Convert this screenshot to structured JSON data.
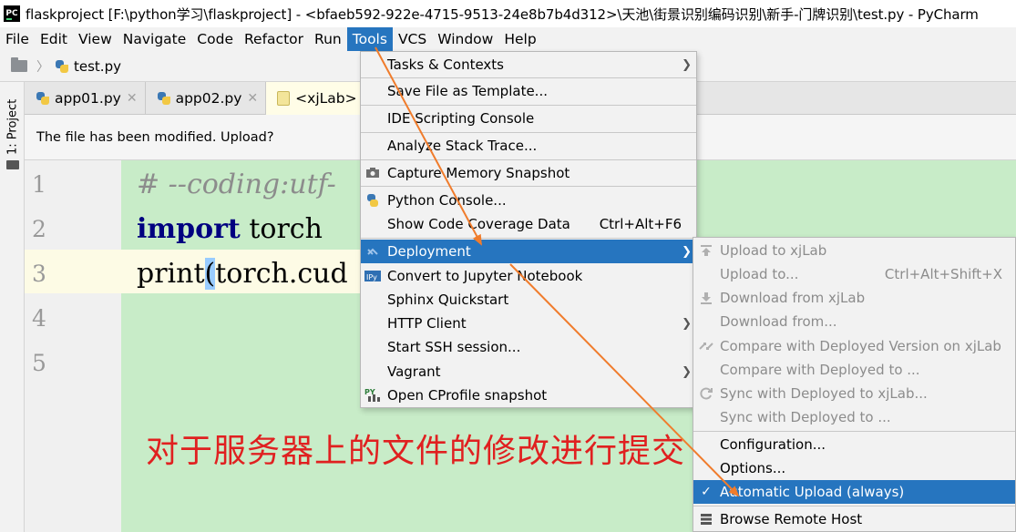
{
  "window": {
    "title": "flaskproject [F:\\python学习\\flaskproject] - <bfaeb592-922e-4715-9513-24e8b7b4d312>\\天池\\街景识别编码识别\\新手-门牌识别\\test.py - PyCharm",
    "logo_text": "PC"
  },
  "menubar": {
    "items": [
      "File",
      "Edit",
      "View",
      "Navigate",
      "Code",
      "Refactor",
      "Run",
      "Tools",
      "VCS",
      "Window",
      "Help"
    ],
    "active": "Tools"
  },
  "breadcrumb": {
    "file": "test.py"
  },
  "sidebar": {
    "project_label": "1: Project"
  },
  "tabs": [
    {
      "label": "app01.py"
    },
    {
      "label": "app02.py"
    },
    {
      "label": "<xjLab> te"
    }
  ],
  "notification": {
    "text": "The file has been modified. Upload?"
  },
  "editor": {
    "line_numbers": [
      "1",
      "2",
      "3",
      "4",
      "5"
    ],
    "lines": {
      "l1": "# --coding:utf-",
      "l2_kw": "import",
      "l2_rest": " torch",
      "l3_a": "print",
      "l3_paren": "(",
      "l3_b": "torch.cud"
    }
  },
  "annotation": {
    "text": "对于服务器上的文件的修改进行提交",
    "color": "#e02020"
  },
  "tools_menu": {
    "items": [
      {
        "label": "Tasks & Contexts",
        "shortcut": "",
        "submenu": true,
        "icon": ""
      },
      {
        "label": "Save File as Template...",
        "shortcut": "",
        "submenu": false,
        "icon": ""
      },
      {
        "label": "IDE Scripting Console",
        "shortcut": "",
        "submenu": false,
        "icon": ""
      },
      {
        "label": "Analyze Stack Trace...",
        "shortcut": "",
        "submenu": false,
        "icon": ""
      },
      {
        "label": "Capture Memory Snapshot",
        "shortcut": "",
        "submenu": false,
        "icon": "memory-snapshot-icon"
      },
      {
        "label": "Python Console...",
        "shortcut": "",
        "submenu": false,
        "icon": "python-icon"
      },
      {
        "label": "Show Code Coverage Data",
        "shortcut": "Ctrl+Alt+F6",
        "submenu": false,
        "icon": ""
      },
      {
        "label": "Deployment",
        "shortcut": "",
        "submenu": true,
        "icon": "deployment-icon"
      },
      {
        "label": "Convert to Jupyter Notebook",
        "shortcut": "",
        "submenu": false,
        "icon": "jupyter-icon"
      },
      {
        "label": "Sphinx Quickstart",
        "shortcut": "",
        "submenu": false,
        "icon": ""
      },
      {
        "label": "HTTP Client",
        "shortcut": "",
        "submenu": true,
        "icon": ""
      },
      {
        "label": "Start SSH session...",
        "shortcut": "",
        "submenu": false,
        "icon": ""
      },
      {
        "label": "Vagrant",
        "shortcut": "",
        "submenu": true,
        "icon": ""
      },
      {
        "label": "Open CProfile snapshot",
        "shortcut": "",
        "submenu": false,
        "icon": "cprofile-icon"
      }
    ],
    "active": "Deployment"
  },
  "deployment_menu": {
    "items": [
      {
        "label": "Upload to xjLab",
        "shortcut": "",
        "enabled": false,
        "icon": "upload-icon"
      },
      {
        "label": "Upload to...",
        "shortcut": "Ctrl+Alt+Shift+X",
        "enabled": false,
        "icon": ""
      },
      {
        "label": "Download from xjLab",
        "shortcut": "",
        "enabled": false,
        "icon": "download-icon"
      },
      {
        "label": "Download from...",
        "shortcut": "",
        "enabled": false,
        "icon": ""
      },
      {
        "label": "Compare with Deployed Version on xjLab",
        "shortcut": "",
        "enabled": false,
        "icon": "compare-icon"
      },
      {
        "label": "Compare with Deployed to ...",
        "shortcut": "",
        "enabled": false,
        "icon": ""
      },
      {
        "label": "Sync with Deployed to xjLab...",
        "shortcut": "",
        "enabled": false,
        "icon": "sync-icon"
      },
      {
        "label": "Sync with Deployed to ...",
        "shortcut": "",
        "enabled": false,
        "icon": ""
      },
      {
        "label": "Configuration...",
        "shortcut": "",
        "enabled": true,
        "icon": ""
      },
      {
        "label": "Options...",
        "shortcut": "",
        "enabled": true,
        "icon": ""
      },
      {
        "label": "Automatic Upload (always)",
        "shortcut": "",
        "enabled": true,
        "icon": "check-icon",
        "checked": true
      },
      {
        "label": "Browse Remote Host",
        "shortcut": "",
        "enabled": true,
        "icon": "remote-host-icon"
      }
    ],
    "active": "Automatic Upload (always)"
  },
  "colors": {
    "selection": "#2675bf",
    "editor_bg": "#c8ecc8",
    "arrow": "#f07c2c"
  }
}
